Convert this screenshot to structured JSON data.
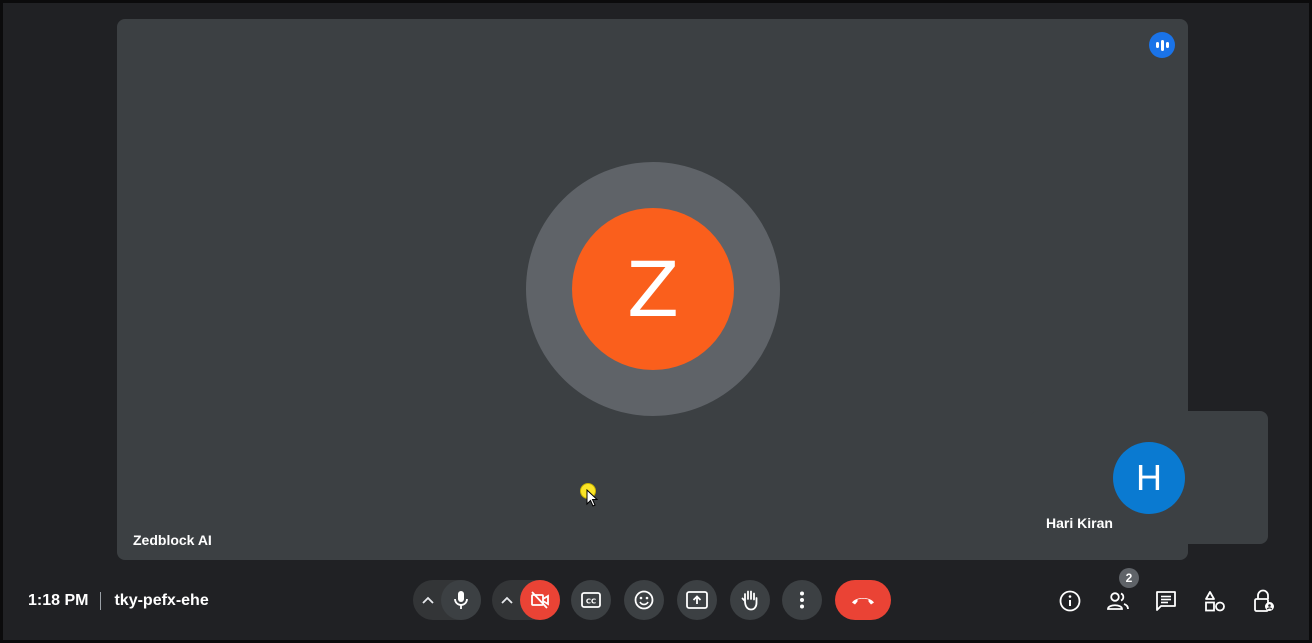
{
  "main_tile": {
    "participant_name": "Zedblock AI",
    "avatar_letter": "Z",
    "avatar_color": "#fa5f1c",
    "speaking_icon": "audio-level-icon"
  },
  "self_tile": {
    "participant_name": "Hari Kiran",
    "avatar_letter": "H",
    "avatar_color": "#0a7ad1"
  },
  "meeting": {
    "time": "1:18 PM",
    "code": "tky-pefx-ehe"
  },
  "controls": {
    "mic_icon": "microphone-icon",
    "camera_icon": "camera-off-icon",
    "camera_color": "#ea4335",
    "captions_icon": "closed-captions-icon",
    "emoji_icon": "emoji-icon",
    "present_icon": "present-screen-icon",
    "hand_icon": "raise-hand-icon",
    "more_icon": "more-vert-icon",
    "end_call_icon": "end-call-icon"
  },
  "side_controls": {
    "participant_count": "2",
    "icons": [
      "info-icon",
      "people-icon",
      "chat-icon",
      "activities-icon",
      "host-controls-icon"
    ]
  }
}
